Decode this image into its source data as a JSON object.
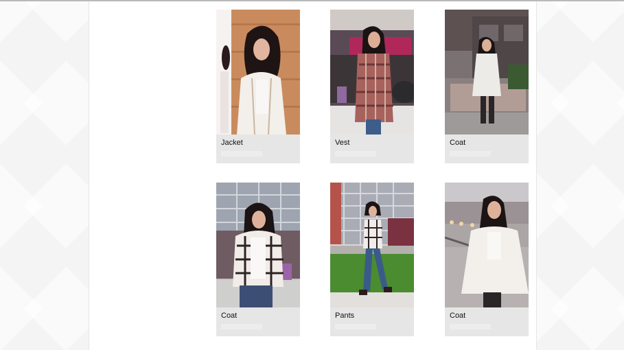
{
  "products": [
    {
      "label": "Jacket",
      "photo": "woman-in-white-jacket-wood-wall"
    },
    {
      "label": "Vest",
      "photo": "woman-in-plaid-vest-street"
    },
    {
      "label": "Coat",
      "photo": "woman-in-white-coat-sidewalk"
    },
    {
      "label": "Coat",
      "photo": "woman-in-plaid-jacket-building"
    },
    {
      "label": "Pants",
      "photo": "woman-in-jeans-lawn"
    },
    {
      "label": "Coat",
      "photo": "woman-in-white-cape-coat-road"
    }
  ],
  "colors": {
    "card_bg": "#e6e6e6",
    "page_bg": "#f4f4f4",
    "content_bg": "#ffffff"
  }
}
